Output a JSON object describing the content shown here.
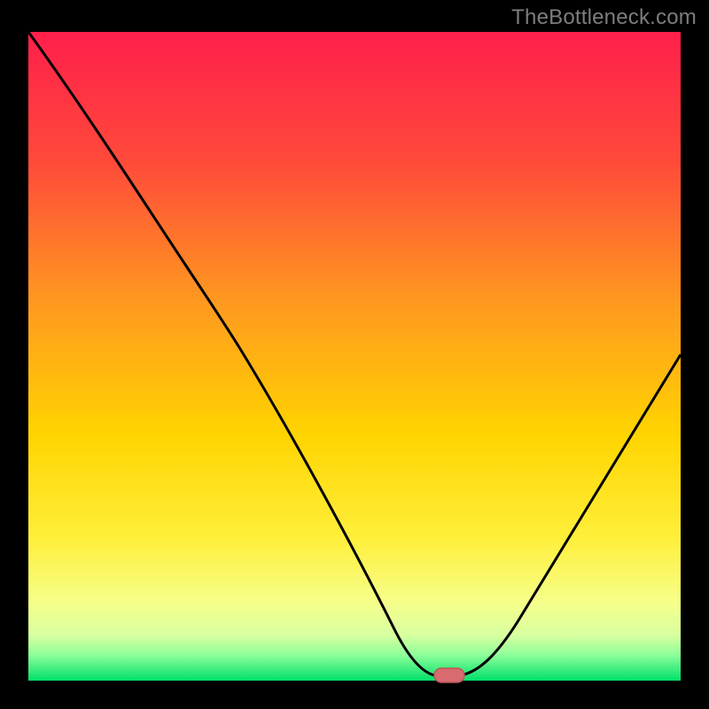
{
  "watermark": "TheBottleneck.com",
  "colors": {
    "frame": "#000000",
    "gradient_top": "#ff1f4b",
    "gradient_mid1": "#ff6a2a",
    "gradient_mid2": "#ffd400",
    "gradient_mid3": "#f6ff55",
    "gradient_bottom": "#00e06a",
    "curve": "#000000",
    "marker_fill": "#d86b6e",
    "marker_stroke": "#bb5558"
  },
  "chart_data": {
    "type": "line",
    "title": "",
    "xlabel": "",
    "ylabel": "",
    "xlim": [
      0,
      100
    ],
    "ylim": [
      0,
      100
    ],
    "x": [
      0,
      12,
      23,
      30,
      40,
      50,
      56,
      60,
      63,
      66,
      72,
      80,
      88,
      96,
      100
    ],
    "values": [
      100,
      84,
      68,
      60,
      44,
      26,
      12,
      4,
      1,
      1,
      6,
      20,
      36,
      52,
      60
    ],
    "optimum_x": 64.5,
    "series_note": "y represents bottleneck percentage (high=red, low=green). Curve minimum marks the balanced configuration."
  }
}
